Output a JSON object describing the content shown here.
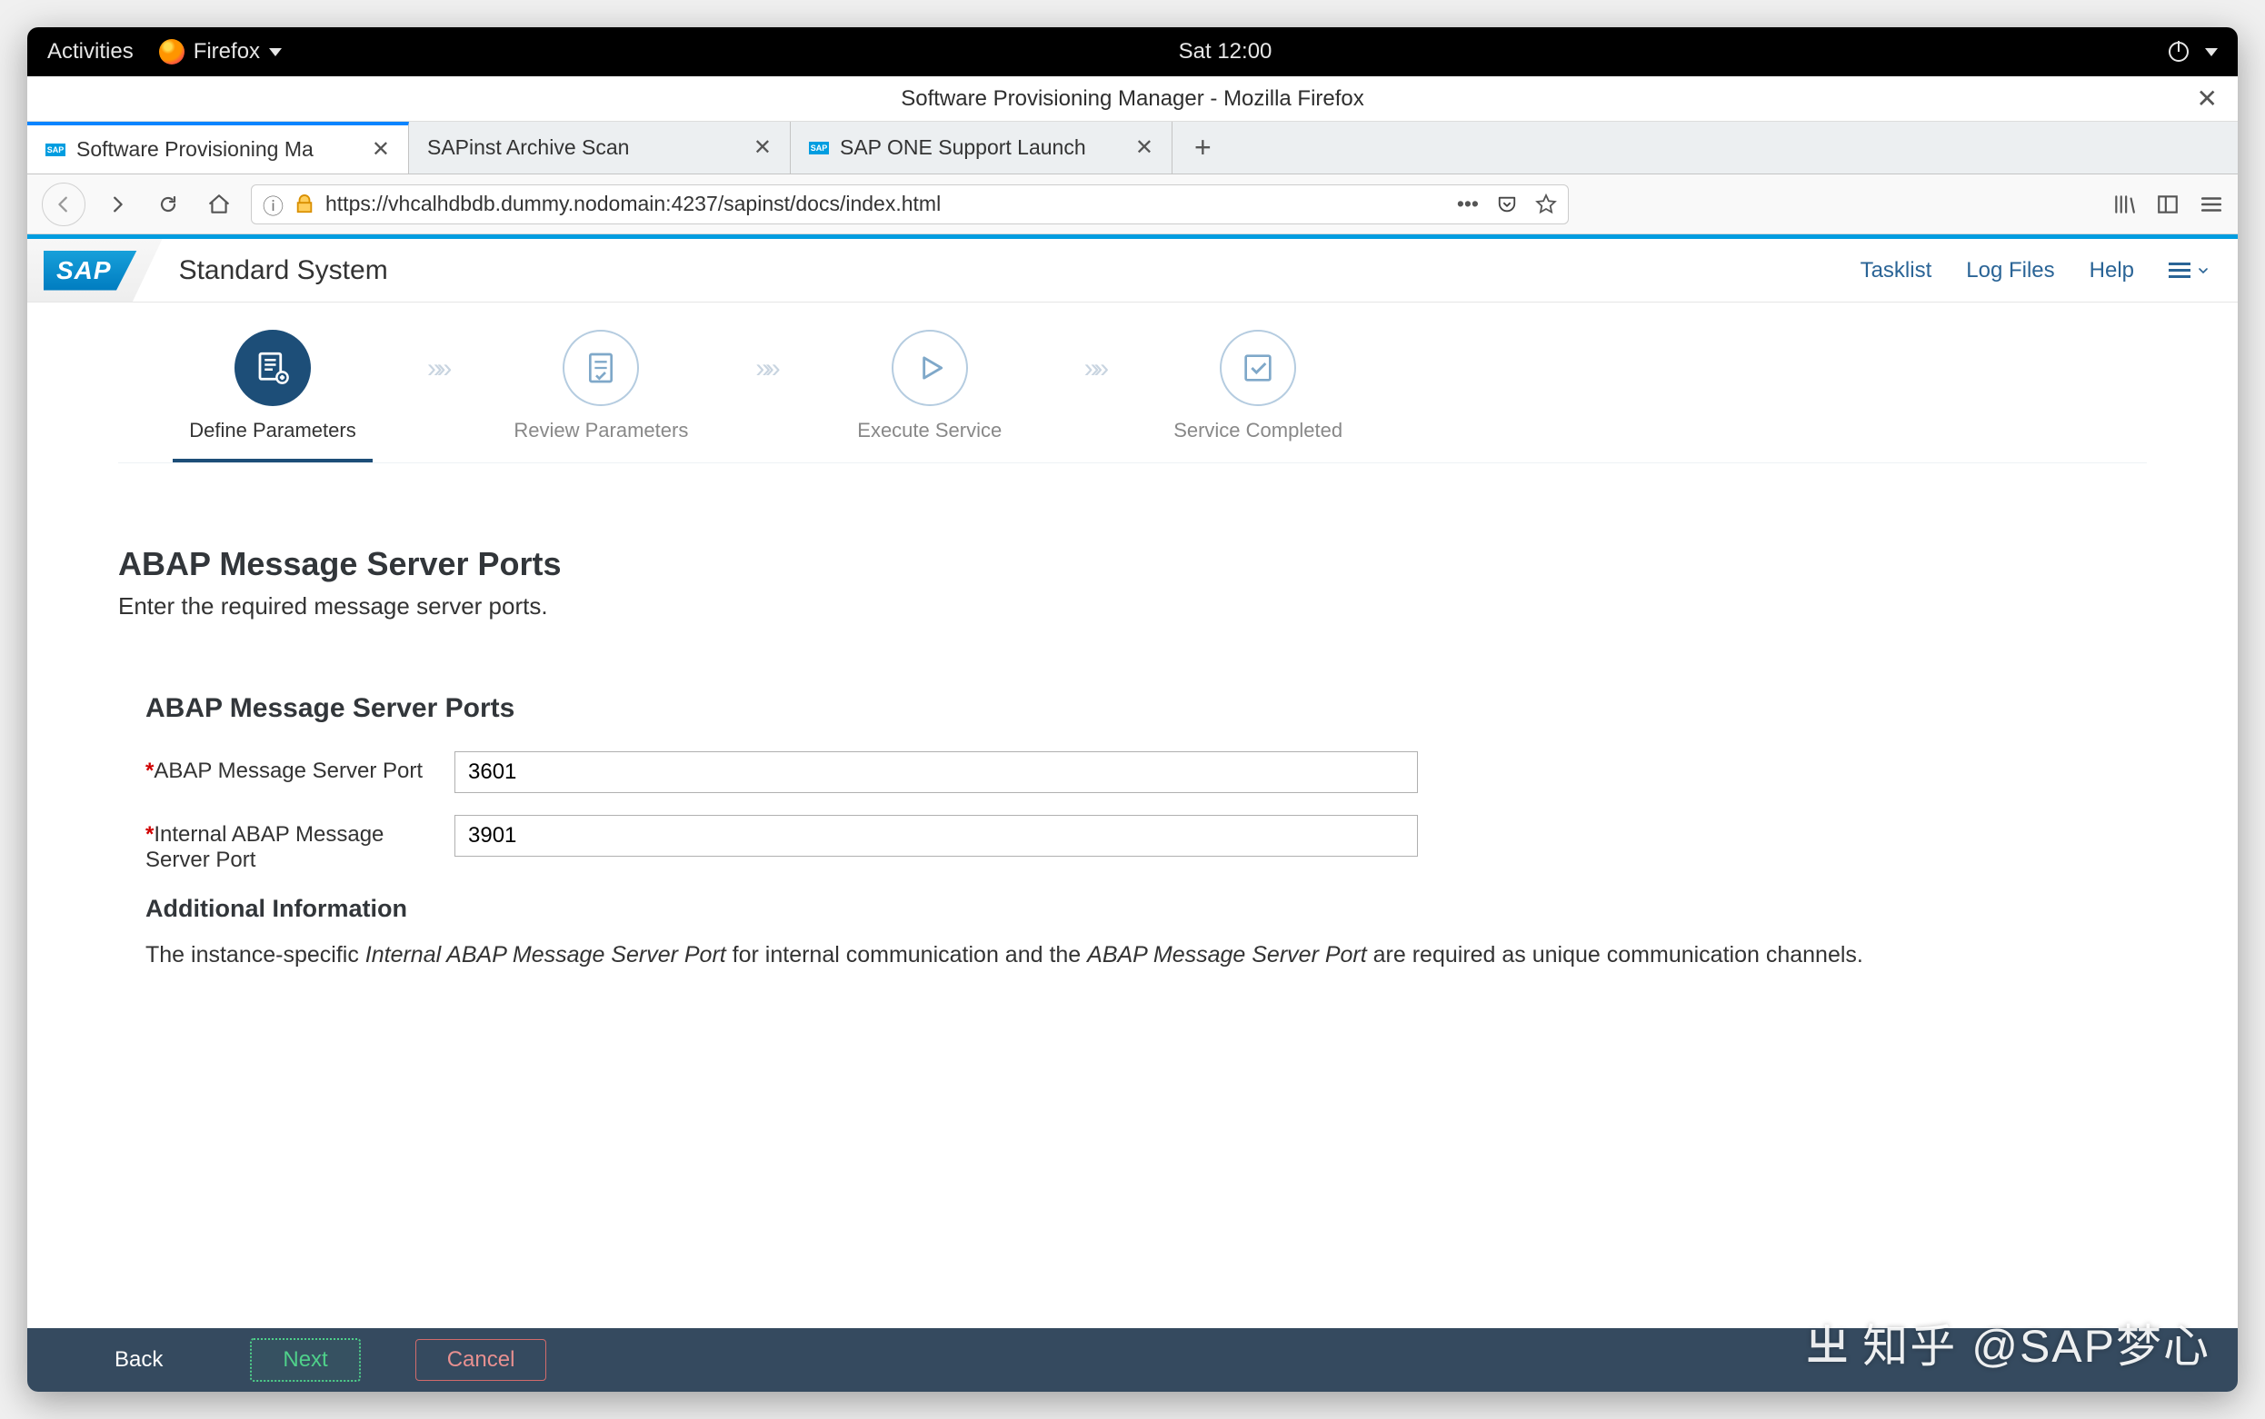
{
  "gnome": {
    "activities": "Activities",
    "firefox": "Firefox",
    "clock": "Sat 12:00"
  },
  "window": {
    "title": "Software Provisioning Manager - Mozilla Firefox"
  },
  "tabs": [
    {
      "label": "Software Provisioning Ma",
      "active": true
    },
    {
      "label": "SAPinst Archive Scan",
      "active": false
    },
    {
      "label": "SAP ONE Support Launch",
      "active": false
    }
  ],
  "url": "https://vhcalhdbdb.dummy.nodomain:4237/sapinst/docs/index.html",
  "sap_header": {
    "logo_text": "SAP",
    "system_title": "Standard System",
    "links": {
      "tasklist": "Tasklist",
      "logfiles": "Log Files",
      "help": "Help"
    }
  },
  "wizard": {
    "steps": [
      {
        "label": "Define Parameters",
        "active": true
      },
      {
        "label": "Review Parameters",
        "active": false
      },
      {
        "label": "Execute Service",
        "active": false
      },
      {
        "label": "Service Completed",
        "active": false
      }
    ]
  },
  "page": {
    "title": "ABAP Message Server Ports",
    "subtitle": "Enter the required message server ports.",
    "section_title": "ABAP Message Server Ports",
    "fields": {
      "abap_port": {
        "label": "ABAP Message Server Port",
        "value": "3601"
      },
      "internal_port": {
        "label": "Internal ABAP Message Server Port",
        "value": "3901"
      }
    },
    "additional": {
      "heading": "Additional Information",
      "text_prefix": "The instance-specific ",
      "em1": "Internal ABAP Message Server Port",
      "text_mid": " for internal communication and the ",
      "em2": "ABAP Message Server Port",
      "text_suffix": " are required as unique communication channels."
    }
  },
  "footer": {
    "back": "Back",
    "next": "Next",
    "cancel": "Cancel"
  },
  "watermark": "知乎 @SAP梦心"
}
